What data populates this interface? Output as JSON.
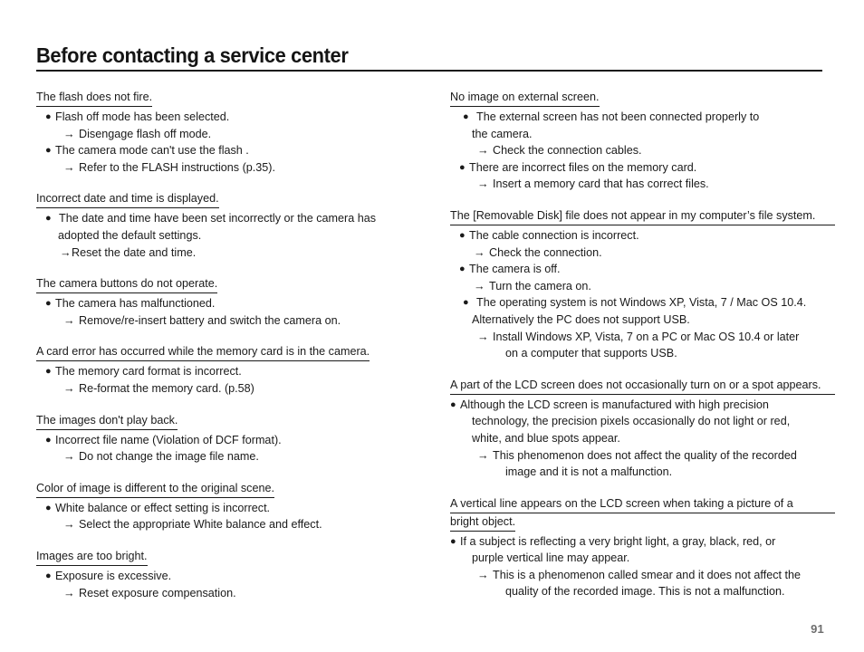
{
  "document": {
    "title": "Before contacting a service center",
    "page_number": "91",
    "arrow_glyph": "→",
    "bullet_glyph": "●"
  },
  "left_column": {
    "sections": [
      {
        "heading": "The flash does not fire.",
        "items": [
          {
            "bullet": "Flash off mode has been selected."
          },
          {
            "arrow": "Disengage flash off mode."
          },
          {
            "bullet": "The camera mode can't use the flash ."
          },
          {
            "arrow": "Refer to the FLASH instructions (p.35)."
          }
        ]
      },
      {
        "heading": "Incorrect date and time is displayed.",
        "items": [
          {
            "bullet": "The date and time have been set incorrectly or the camera has"
          },
          {
            "cont": "adopted the default settings."
          },
          {
            "arrow": "Reset the date and time."
          }
        ]
      },
      {
        "heading": "The camera buttons do not operate.",
        "items": [
          {
            "bullet": "The camera has malfunctioned."
          },
          {
            "arrow": "Remove/re-insert battery and switch the camera on."
          }
        ]
      },
      {
        "heading": "A card error has occurred while the memory card is in the camera.",
        "items": [
          {
            "bullet": "The memory card format is incorrect."
          },
          {
            "arrow": "Re-format the memory card. (p.58)"
          }
        ]
      },
      {
        "heading": "The images don't play back.",
        "items": [
          {
            "bullet": "Incorrect file name (Violation of DCF format)."
          },
          {
            "arrow": "Do not change the image file name."
          }
        ]
      },
      {
        "heading": "Color of image is different to the original scene.",
        "items": [
          {
            "bullet": "White balance or effect setting is incorrect."
          },
          {
            "arrow": "Select the appropriate White balance and effect."
          }
        ]
      },
      {
        "heading": "Images are too bright.",
        "items": [
          {
            "bullet": "Exposure is excessive."
          },
          {
            "arrow": "Reset exposure compensation."
          }
        ]
      }
    ]
  },
  "right_column": {
    "sections": [
      {
        "heading": "No image on external screen.",
        "items": [
          {
            "bullet": "The external screen has not been connected properly to"
          },
          {
            "cont": "the camera."
          },
          {
            "arrow": "Check the connection cables."
          },
          {
            "bullet": "There are incorrect files on the memory card."
          },
          {
            "arrow": "Insert a memory card that has correct files."
          }
        ]
      },
      {
        "heading": "The [Removable Disk] file does not appear in my computer’s file system.",
        "items": [
          {
            "bullet": "The cable connection is incorrect."
          },
          {
            "arrow": "Check the connection."
          },
          {
            "bullet": "The camera is off."
          },
          {
            "arrow": "Turn the camera on."
          },
          {
            "bullet": "The operating system is not Windows XP, Vista, 7 / Mac OS 10.4."
          },
          {
            "cont": "Alternatively the PC does not support USB."
          },
          {
            "arrow": "Install Windows XP, Vista, 7 on a PC or Mac OS 10.4 or later"
          },
          {
            "cont2": "on a computer that supports USB."
          }
        ]
      },
      {
        "heading": "A part of the LCD screen does not occasionally turn on or a spot appears.",
        "items": [
          {
            "bullet": "Although the LCD screen is manufactured with high precision"
          },
          {
            "cont": "technology, the precision pixels occasionally do not light or red,"
          },
          {
            "cont_b": "white, and blue spots appear."
          },
          {
            "arrow": "This phenomenon does not affect the quality of the recorded"
          },
          {
            "cont2": "image and it is not a malfunction."
          }
        ]
      },
      {
        "heading_line1": "A vertical line appears on the LCD screen when taking a picture of a",
        "heading_line2": "bright object.",
        "items": [
          {
            "bullet": "If a subject is reflecting a very bright light, a gray, black, red, or"
          },
          {
            "cont": "purple vertical line may appear."
          },
          {
            "arrow": "This is a phenomenon called smear and it does not affect the"
          },
          {
            "cont2": "quality of the recorded image. This is not a malfunction."
          }
        ]
      }
    ]
  }
}
